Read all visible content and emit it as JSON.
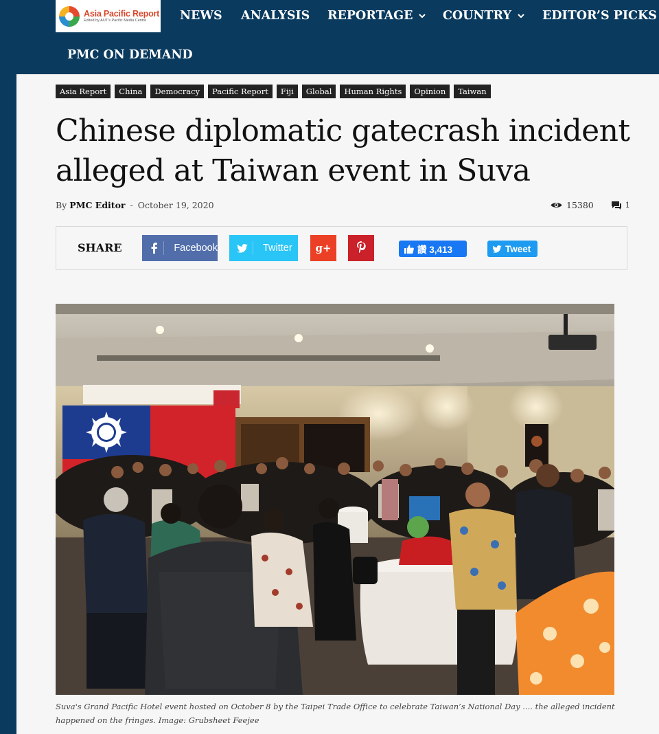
{
  "site": {
    "logo_title": "Asia Pacific Report",
    "logo_subtitle": "Edited by AUT's Pacific Media Centre"
  },
  "nav": {
    "items": [
      {
        "label": "NEWS"
      },
      {
        "label": "ANALYSIS"
      },
      {
        "label": "REPORTAGE"
      },
      {
        "label": "COUNTRY"
      },
      {
        "label": "EDITOR’S PICKS"
      },
      {
        "label": "PMC ON DEMAND"
      }
    ]
  },
  "article": {
    "tags": [
      "Asia Report",
      "China",
      "Democracy",
      "Pacific Report",
      "Fiji",
      "Global",
      "Human Rights",
      "Opinion",
      "Taiwan"
    ],
    "headline": "Chinese diplomatic gatecrash incident alleged at Taiwan event in Suva",
    "byline_prefix": "By",
    "author": "PMC Editor",
    "byline_sep": "-",
    "date": "October 19, 2020",
    "views": "15380",
    "comments": "1",
    "caption": "Suva's Grand Pacific Hotel event hosted on October 8 by the Taipei Trade Office to celebrate Taiwan’s National Day .... the alleged incident happened on the fringes. Image: Grubsheet Feejee"
  },
  "share": {
    "label": "SHARE",
    "facebook": "Facebook",
    "twitter": "Twitter",
    "like_label": "讚 3,413",
    "tweet_label": "Tweet"
  },
  "colors": {
    "navy": "#0a3a5e",
    "facebook": "#516eab",
    "twitter": "#29c5f6",
    "googleplus": "#eb4026",
    "pinterest": "#ca212a",
    "fb_like": "#1877f2",
    "tweet": "#1d9bf0"
  },
  "icons": [
    "chevron-down-icon",
    "eye-icon",
    "comment-icon",
    "facebook-icon",
    "twitter-icon",
    "googleplus-icon",
    "pinterest-icon",
    "thumbs-up-icon"
  ]
}
